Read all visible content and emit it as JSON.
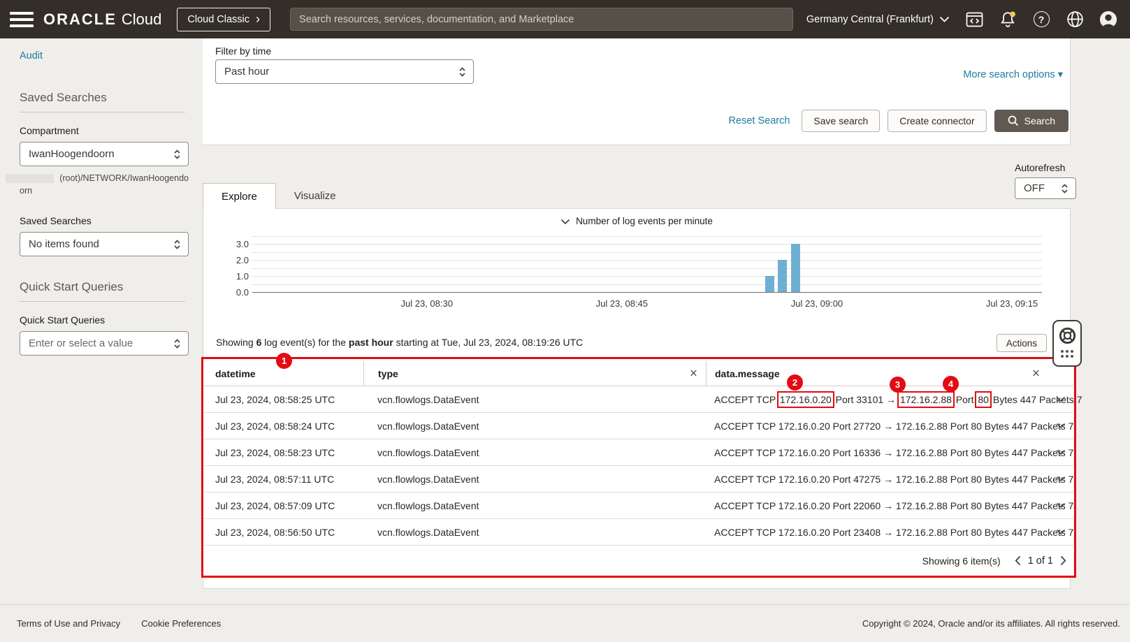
{
  "header": {
    "brand_oracle": "ORACLE",
    "brand_cloud": "Cloud",
    "cloud_classic_button": "Cloud Classic",
    "cloud_classic_chevron": "›",
    "search_placeholder": "Search resources, services, documentation, and Marketplace",
    "region_selector": "Germany Central (Frankfurt)",
    "help_glyph": "?"
  },
  "sidebar": {
    "audit_link": "Audit",
    "saved_searches_heading": "Saved Searches",
    "compartment_label": "Compartment",
    "compartment_value": "IwanHoogendoorn",
    "compartment_path_line1": "(root)/NETWORK/IwanHoogendo",
    "compartment_path_line2": "orn",
    "saved_searches_label": "Saved Searches",
    "saved_searches_value": "No items found",
    "quick_start_heading": "Quick Start Queries",
    "quick_start_label": "Quick Start Queries",
    "quick_start_placeholder": "Enter or select a value"
  },
  "search_panel": {
    "filter_by_time_label": "Filter by time",
    "filter_by_time_value": "Past hour",
    "more_search_options": "More search options ▾",
    "reset_search": "Reset Search",
    "save_search": "Save search",
    "create_connector": "Create connector",
    "search_button": "Search"
  },
  "autorefresh": {
    "label": "Autorefresh",
    "value": "OFF"
  },
  "tabs": {
    "explore": "Explore",
    "visualize": "Visualize"
  },
  "chart_data": {
    "type": "bar",
    "title": "Number of log events per minute",
    "ylabel": "",
    "xlabel": "",
    "ylim": [
      0,
      3.5
    ],
    "y_ticks": [
      0.0,
      1.0,
      2.0,
      3.0
    ],
    "grid": true,
    "bar_color": "#6fb0d2",
    "x_tick_labels": [
      "Jul 23, 08:30",
      "Jul 23, 08:45",
      "Jul 23, 09:00",
      "Jul 23, 09:15"
    ],
    "x_tick_fracs": [
      0.221,
      0.468,
      0.715,
      0.962
    ],
    "bars": [
      {
        "minute": "Jul 23, 08:56",
        "value": 1,
        "x_frac": 0.6496
      },
      {
        "minute": "Jul 23, 08:57",
        "value": 2,
        "x_frac": 0.6655
      },
      {
        "minute": "Jul 23, 08:58",
        "value": 3,
        "x_frac": 0.6823
      }
    ]
  },
  "results_bar": {
    "summary": [
      "Showing ",
      "6",
      " log event(s) for the ",
      "past hour",
      " starting at Tue, Jul 23, 2024, 08:19:26 UTC"
    ],
    "actions_button": "Actions"
  },
  "log_table": {
    "columns": [
      "datetime",
      "type",
      "data.message"
    ],
    "close_glyph": "×",
    "rows": [
      {
        "datetime": "Jul 23, 2024, 08:58:25 UTC",
        "type": "vcn.flowlogs.DataEvent",
        "message_segments": [
          {
            "t": "ACCEPT TCP "
          },
          {
            "t": "172.16.0.20",
            "boxed": true
          },
          {
            "t": " Port 33101 → "
          },
          {
            "t": "172.16.2.88",
            "boxed": true
          },
          {
            "t": " Port "
          },
          {
            "t": "80",
            "boxed": true
          },
          {
            "t": " Bytes 447 Packets 7"
          }
        ]
      },
      {
        "datetime": "Jul 23, 2024, 08:58:24 UTC",
        "type": "vcn.flowlogs.DataEvent",
        "message": "ACCEPT TCP 172.16.0.20 Port 27720 → 172.16.2.88 Port 80 Bytes 447 Packets 7"
      },
      {
        "datetime": "Jul 23, 2024, 08:58:23 UTC",
        "type": "vcn.flowlogs.DataEvent",
        "message": "ACCEPT TCP 172.16.0.20 Port 16336 → 172.16.2.88 Port 80 Bytes 447 Packets 7"
      },
      {
        "datetime": "Jul 23, 2024, 08:57:11 UTC",
        "type": "vcn.flowlogs.DataEvent",
        "message": "ACCEPT TCP 172.16.0.20 Port 47275 → 172.16.2.88 Port 80 Bytes 447 Packets 7"
      },
      {
        "datetime": "Jul 23, 2024, 08:57:09 UTC",
        "type": "vcn.flowlogs.DataEvent",
        "message": "ACCEPT TCP 172.16.0.20 Port 22060 → 172.16.2.88 Port 80 Bytes 447 Packets 7"
      },
      {
        "datetime": "Jul 23, 2024, 08:56:50 UTC",
        "type": "vcn.flowlogs.DataEvent",
        "message": "ACCEPT TCP 172.16.0.20 Port 23408 → 172.16.2.88 Port 80 Bytes 447 Packets 7"
      }
    ],
    "footer_showing": "Showing 6 item(s)",
    "pagination": "1 of 1"
  },
  "annotations": {
    "callouts": [
      "1",
      "2",
      "3",
      "4"
    ],
    "color": "#e30b13"
  },
  "page_footer": {
    "terms": "Terms of Use and Privacy",
    "cookies": "Cookie Preferences",
    "copyright": "Copyright © 2024, Oracle and/or its affiliates. All rights reserved."
  },
  "colors": {
    "header_bg": "#332e28",
    "accent_link": "#1e7b9f",
    "bar_blue": "#6fb0d2",
    "annotation_red": "#e30b13",
    "search_button_bg": "#5f5951",
    "notification_dot": "#efc95c"
  }
}
